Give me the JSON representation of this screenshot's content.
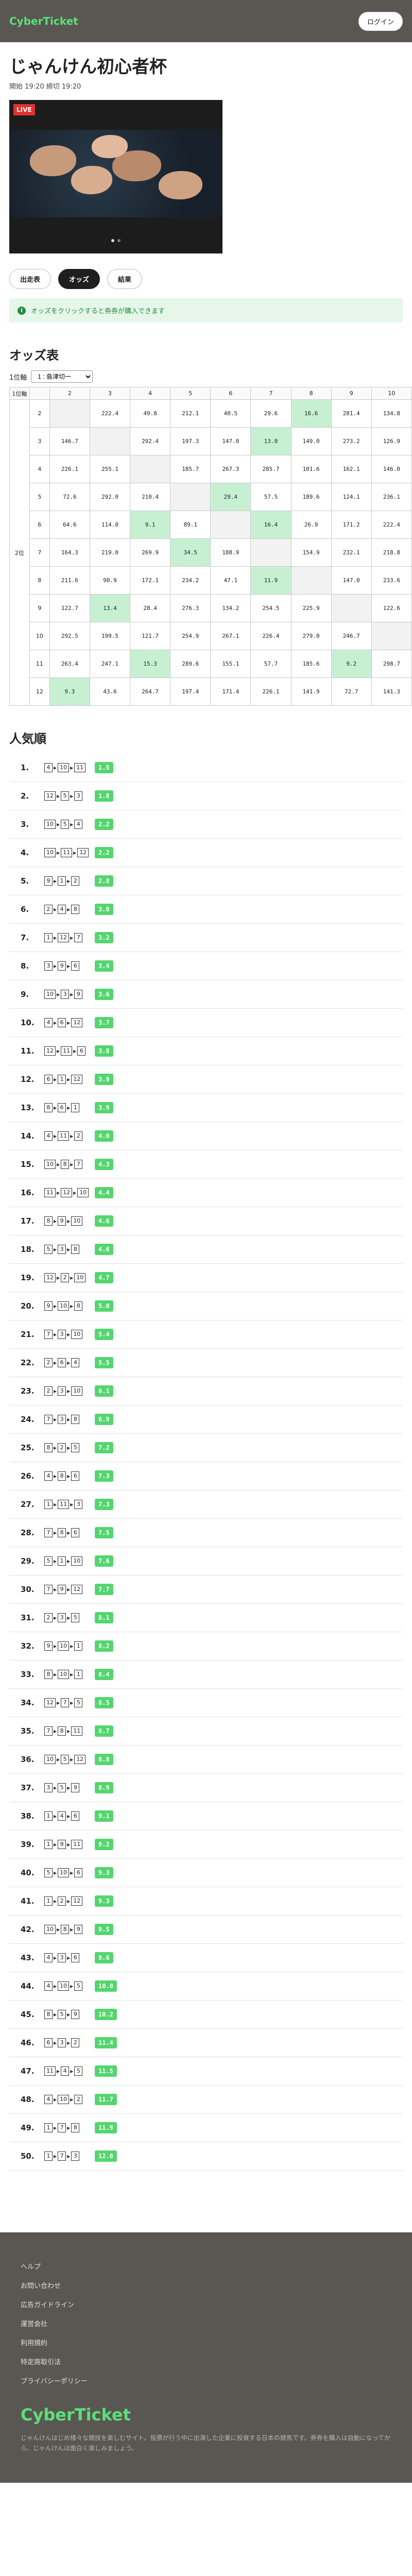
{
  "header": {
    "logo": "CyberTicket",
    "login": "ログイン"
  },
  "race": {
    "title": "じゃんけん初心者杯",
    "time": "開始 19:20 締切 19:20"
  },
  "video": {
    "live_label": "LIVE"
  },
  "tabs": [
    "出走表",
    "オッズ",
    "結果"
  ],
  "notice": "オッズをクリックすると券券が購入できます",
  "odds_section": {
    "title": "オッズ表",
    "first_label": "1位軸",
    "select_value": "1 : 島津切一",
    "second_label": "2位",
    "columns": [
      "2",
      "3",
      "4",
      "5",
      "6",
      "7",
      "8",
      "9",
      "10"
    ],
    "rows": [
      {
        "row": "2",
        "cells": [
          "",
          "222.4",
          "49.8",
          "212.1",
          "40.5",
          "29.6",
          "16.6",
          "281.4",
          "134.8"
        ],
        "hl": [
          6
        ]
      },
      {
        "row": "3",
        "cells": [
          "146.7",
          "",
          "292.4",
          "197.3",
          "147.0",
          "13.0",
          "149.0",
          "273.2",
          "126.9"
        ],
        "hl": [
          5
        ]
      },
      {
        "row": "4",
        "cells": [
          "226.1",
          "255.1",
          "",
          "185.7",
          "267.3",
          "285.7",
          "101.6",
          "162.1",
          "146.0"
        ],
        "hl": []
      },
      {
        "row": "5",
        "cells": [
          "72.6",
          "292.0",
          "210.4",
          "",
          "29.4",
          "57.5",
          "189.6",
          "124.1",
          "236.1"
        ],
        "hl": [
          4
        ]
      },
      {
        "row": "6",
        "cells": [
          "64.6",
          "114.0",
          "9.1",
          "89.1",
          "",
          "16.4",
          "26.9",
          "171.2",
          "222.4"
        ],
        "hl": [
          2,
          5
        ]
      },
      {
        "row": "7",
        "cells": [
          "164.3",
          "219.0",
          "269.9",
          "34.5",
          "188.9",
          "",
          "154.9",
          "232.1",
          "218.8"
        ],
        "hl": [
          3
        ]
      },
      {
        "row": "8",
        "cells": [
          "211.6",
          "90.9",
          "172.1",
          "234.2",
          "47.1",
          "11.9",
          "",
          "147.0",
          "233.6"
        ],
        "hl": [
          5
        ]
      },
      {
        "row": "9",
        "cells": [
          "122.7",
          "13.4",
          "28.4",
          "276.3",
          "134.2",
          "254.5",
          "225.9",
          "",
          "122.6"
        ],
        "hl": [
          1
        ]
      },
      {
        "row": "10",
        "cells": [
          "292.5",
          "199.5",
          "121.7",
          "254.9",
          "267.1",
          "226.4",
          "279.0",
          "246.7",
          ""
        ],
        "hl": []
      },
      {
        "row": "11",
        "cells": [
          "263.4",
          "247.1",
          "15.3",
          "289.6",
          "155.1",
          "57.7",
          "185.6",
          "9.2",
          "298.7"
        ],
        "hl": [
          2,
          7
        ]
      },
      {
        "row": "12",
        "cells": [
          "9.3",
          "43.6",
          "264.7",
          "197.4",
          "171.4",
          "226.1",
          "141.9",
          "72.7",
          "141.3"
        ],
        "hl": [
          0
        ]
      }
    ]
  },
  "popularity": {
    "title": "人気順",
    "items": [
      {
        "rank": "1.",
        "nums": [
          "4",
          "10",
          "11"
        ],
        "odds": "1.5"
      },
      {
        "rank": "2.",
        "nums": [
          "12",
          "5",
          "3"
        ],
        "odds": "1.8"
      },
      {
        "rank": "3.",
        "nums": [
          "10",
          "5",
          "4"
        ],
        "odds": "2.2"
      },
      {
        "rank": "4.",
        "nums": [
          "10",
          "11",
          "12"
        ],
        "odds": "2.2"
      },
      {
        "rank": "5.",
        "nums": [
          "9",
          "1",
          "2"
        ],
        "odds": "2.8"
      },
      {
        "rank": "6.",
        "nums": [
          "2",
          "4",
          "8"
        ],
        "odds": "3.0"
      },
      {
        "rank": "7.",
        "nums": [
          "1",
          "12",
          "7"
        ],
        "odds": "3.2"
      },
      {
        "rank": "8.",
        "nums": [
          "3",
          "9",
          "6"
        ],
        "odds": "3.4"
      },
      {
        "rank": "9.",
        "nums": [
          "10",
          "3",
          "9"
        ],
        "odds": "3.6"
      },
      {
        "rank": "10.",
        "nums": [
          "4",
          "6",
          "12"
        ],
        "odds": "3.7"
      },
      {
        "rank": "11.",
        "nums": [
          "12",
          "11",
          "6"
        ],
        "odds": "3.8"
      },
      {
        "rank": "12.",
        "nums": [
          "6",
          "1",
          "12"
        ],
        "odds": "3.9"
      },
      {
        "rank": "13.",
        "nums": [
          "8",
          "6",
          "1"
        ],
        "odds": "3.9"
      },
      {
        "rank": "14.",
        "nums": [
          "4",
          "11",
          "2"
        ],
        "odds": "4.0"
      },
      {
        "rank": "15.",
        "nums": [
          "10",
          "8",
          "7"
        ],
        "odds": "4.3"
      },
      {
        "rank": "16.",
        "nums": [
          "11",
          "12",
          "10"
        ],
        "odds": "4.4"
      },
      {
        "rank": "17.",
        "nums": [
          "8",
          "9",
          "10"
        ],
        "odds": "4.6"
      },
      {
        "rank": "18.",
        "nums": [
          "5",
          "3",
          "8"
        ],
        "odds": "4.6"
      },
      {
        "rank": "19.",
        "nums": [
          "12",
          "2",
          "10"
        ],
        "odds": "4.7"
      },
      {
        "rank": "20.",
        "nums": [
          "9",
          "10",
          "8"
        ],
        "odds": "5.0"
      },
      {
        "rank": "21.",
        "nums": [
          "7",
          "3",
          "10"
        ],
        "odds": "5.4"
      },
      {
        "rank": "22.",
        "nums": [
          "2",
          "6",
          "4"
        ],
        "odds": "5.5"
      },
      {
        "rank": "23.",
        "nums": [
          "2",
          "3",
          "10"
        ],
        "odds": "6.1"
      },
      {
        "rank": "24.",
        "nums": [
          "7",
          "3",
          "8"
        ],
        "odds": "6.9"
      },
      {
        "rank": "25.",
        "nums": [
          "8",
          "2",
          "5"
        ],
        "odds": "7.2"
      },
      {
        "rank": "26.",
        "nums": [
          "4",
          "8",
          "6"
        ],
        "odds": "7.3"
      },
      {
        "rank": "27.",
        "nums": [
          "1",
          "11",
          "3"
        ],
        "odds": "7.3"
      },
      {
        "rank": "28.",
        "nums": [
          "7",
          "8",
          "6"
        ],
        "odds": "7.5"
      },
      {
        "rank": "29.",
        "nums": [
          "5",
          "1",
          "10"
        ],
        "odds": "7.6"
      },
      {
        "rank": "30.",
        "nums": [
          "7",
          "9",
          "12"
        ],
        "odds": "7.7"
      },
      {
        "rank": "31.",
        "nums": [
          "2",
          "3",
          "5"
        ],
        "odds": "8.1"
      },
      {
        "rank": "32.",
        "nums": [
          "9",
          "10",
          "1"
        ],
        "odds": "8.2"
      },
      {
        "rank": "33.",
        "nums": [
          "8",
          "10",
          "1"
        ],
        "odds": "8.4"
      },
      {
        "rank": "34.",
        "nums": [
          "12",
          "7",
          "5"
        ],
        "odds": "8.5"
      },
      {
        "rank": "35.",
        "nums": [
          "7",
          "8",
          "11"
        ],
        "odds": "8.7"
      },
      {
        "rank": "36.",
        "nums": [
          "10",
          "5",
          "12"
        ],
        "odds": "8.8"
      },
      {
        "rank": "37.",
        "nums": [
          "3",
          "5",
          "9"
        ],
        "odds": "8.9"
      },
      {
        "rank": "38.",
        "nums": [
          "1",
          "4",
          "6"
        ],
        "odds": "9.1"
      },
      {
        "rank": "39.",
        "nums": [
          "1",
          "9",
          "11"
        ],
        "odds": "9.2"
      },
      {
        "rank": "40.",
        "nums": [
          "5",
          "10",
          "6"
        ],
        "odds": "9.3"
      },
      {
        "rank": "41.",
        "nums": [
          "1",
          "2",
          "12"
        ],
        "odds": "9.3"
      },
      {
        "rank": "42.",
        "nums": [
          "10",
          "8",
          "9"
        ],
        "odds": "9.5"
      },
      {
        "rank": "43.",
        "nums": [
          "4",
          "3",
          "6"
        ],
        "odds": "9.6"
      },
      {
        "rank": "44.",
        "nums": [
          "4",
          "10",
          "5"
        ],
        "odds": "10.0"
      },
      {
        "rank": "45.",
        "nums": [
          "8",
          "5",
          "9"
        ],
        "odds": "10.2"
      },
      {
        "rank": "46.",
        "nums": [
          "6",
          "3",
          "2"
        ],
        "odds": "11.4"
      },
      {
        "rank": "47.",
        "nums": [
          "11",
          "4",
          "5"
        ],
        "odds": "11.5"
      },
      {
        "rank": "48.",
        "nums": [
          "4",
          "10",
          "2"
        ],
        "odds": "11.7"
      },
      {
        "rank": "49.",
        "nums": [
          "1",
          "7",
          "8"
        ],
        "odds": "11.9"
      },
      {
        "rank": "50.",
        "nums": [
          "1",
          "7",
          "3"
        ],
        "odds": "12.0"
      }
    ]
  },
  "footer": {
    "links": [
      "ヘルプ",
      "お問い合わせ",
      "広告ガイドライン",
      "運営会社",
      "利用規約",
      "特定商取引法",
      "プライバシーポリシー"
    ],
    "logo": "CyberTicket",
    "note": "じゃんけんはじめ様々な競技を楽しむサイト。投票が行う中に出演した企業に投資する日本の競馬です。券券を購入は自動になってから、じゃんけんは面白く楽しみましょう。"
  },
  "colors": {
    "header_bg": "#5a5752",
    "brand_green": "#5ae07a",
    "odds_green": "#55d56f",
    "live_red": "#e53030"
  }
}
